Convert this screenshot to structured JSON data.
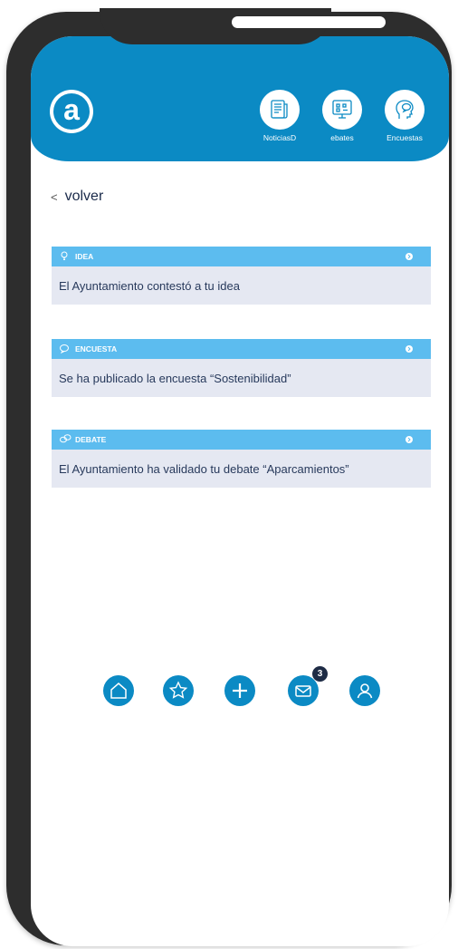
{
  "header": {
    "logo_letter": "a",
    "nav": [
      {
        "label": "NoticiasD",
        "icon": "newspaper-icon"
      },
      {
        "label": "ebates",
        "icon": "debate-board-icon"
      },
      {
        "label": "Encuestas",
        "icon": "survey-head-icon"
      }
    ]
  },
  "back": {
    "label": "volver",
    "chevron": "<"
  },
  "notifications": [
    {
      "type": "IDEA",
      "icon": "lightbulb-icon",
      "text": "El Ayuntamiento contestó a tu idea"
    },
    {
      "type": "ENCUESTA",
      "icon": "survey-icon",
      "text": "Se ha publicado la encuesta “Sostenibilidad”"
    },
    {
      "type": "DEBATE",
      "icon": "chat-bubbles-icon",
      "text": "El Ayuntamiento ha validado tu debate “Aparcamientos”"
    }
  ],
  "tabbar": {
    "items": [
      "home-icon",
      "star-icon",
      "plus-icon",
      "mail-icon",
      "user-icon"
    ],
    "mail_badge": "3"
  },
  "colors": {
    "primary": "#0b8ac4",
    "card_header": "#5cbcef",
    "card_body": "#e5e8f2",
    "frame": "#2d2d2d"
  }
}
